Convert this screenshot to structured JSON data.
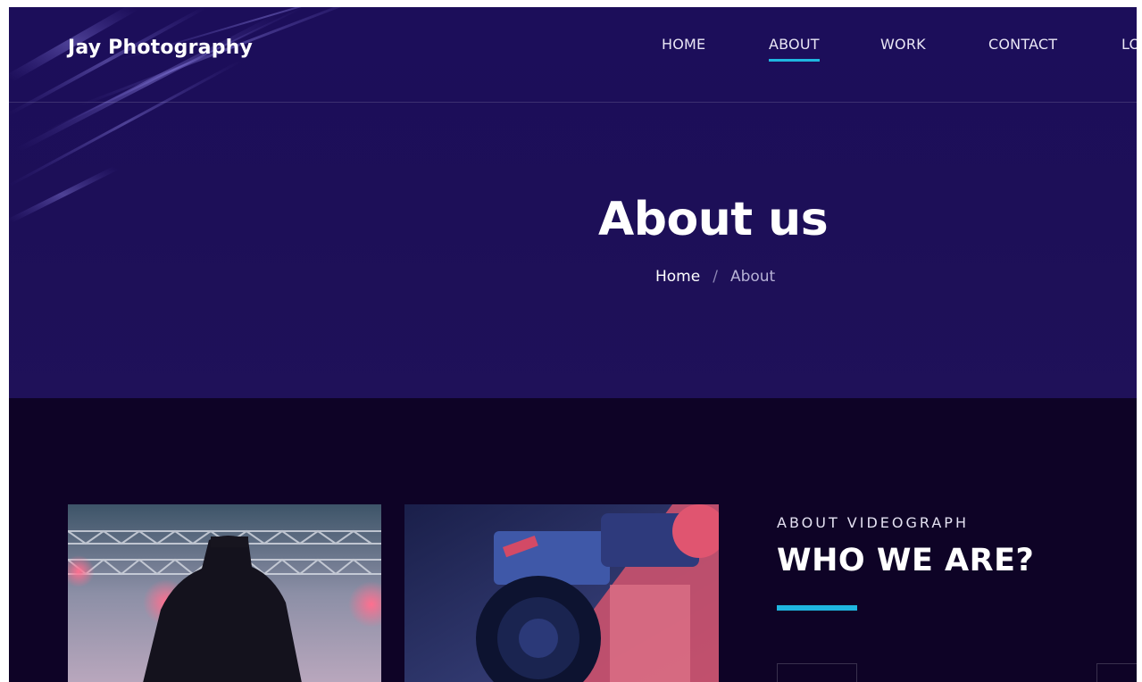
{
  "brand": {
    "name": "Jay Photography"
  },
  "nav": {
    "items": [
      {
        "label": "HOME",
        "active": false
      },
      {
        "label": "ABOUT",
        "active": true
      },
      {
        "label": "WORK",
        "active": false
      },
      {
        "label": "CONTACT",
        "active": false
      },
      {
        "label": "LO",
        "active": false
      }
    ]
  },
  "hero": {
    "title": "About us",
    "breadcrumb": {
      "home": "Home",
      "separator": "/",
      "current": "About"
    }
  },
  "about": {
    "eyebrow": "ABOUT VIDEOGRAPH",
    "title": "WHO WE ARE?",
    "images": [
      {
        "icon": "concert-silhouette-photo"
      },
      {
        "icon": "video-camera-photo"
      }
    ]
  },
  "colors": {
    "hero_bg": "#1d0f58",
    "section_bg": "#0e0326",
    "accent": "#1fb6e0",
    "text": "#ffffff"
  }
}
